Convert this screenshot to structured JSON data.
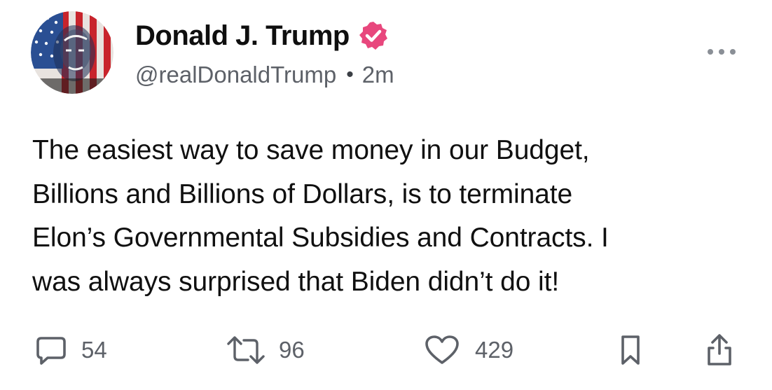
{
  "post": {
    "author": {
      "display_name": "Donald J. Trump",
      "handle": "@realDonaldTrump",
      "verified": true,
      "verified_badge_color": "#e8477d",
      "avatar_icon": "flag-portrait-avatar"
    },
    "separator": "•",
    "timestamp": "2m",
    "more_icon": "more-horizontal-icon",
    "text_lines": [
      "The easiest way to save money in our Budget,",
      "Billions and Billions of Dollars, is to terminate",
      "Elon’s Governmental Subsidies and Contracts. I",
      "was always surprised that Biden didn’t do it!"
    ],
    "actions": {
      "replies": {
        "icon": "comment-icon",
        "count": "54"
      },
      "reposts": {
        "icon": "repost-icon",
        "count": "96"
      },
      "likes": {
        "icon": "heart-icon",
        "count": "429"
      },
      "bookmark": {
        "icon": "bookmark-icon"
      },
      "share": {
        "icon": "share-icon"
      }
    },
    "colors": {
      "text": "#101010",
      "muted": "#5d6168",
      "background": "#ffffff"
    }
  }
}
